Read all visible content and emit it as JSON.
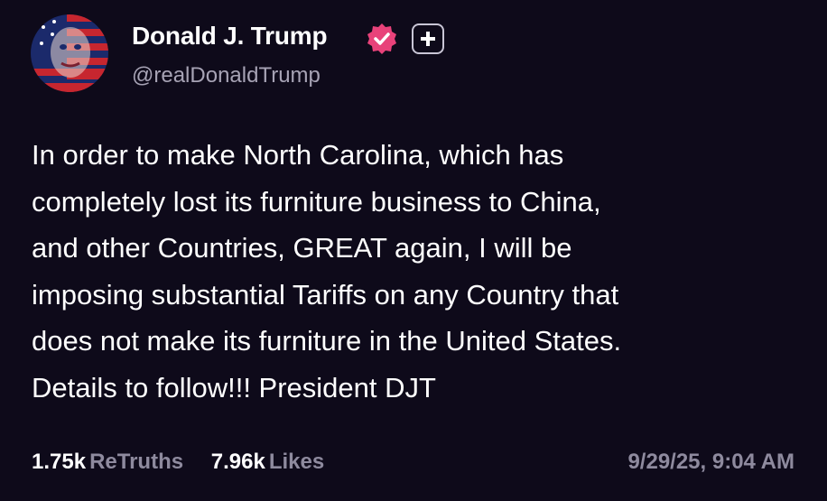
{
  "author": {
    "display_name": "Donald J. Trump",
    "handle": "@realDonaldTrump",
    "avatar_icon": "flag-portrait-avatar",
    "verified_icon": "verified-badge-icon",
    "follow_icon": "plus-icon"
  },
  "post": {
    "lines": [
      "In order to make North Carolina, which has",
      "completely lost its furniture business to China,",
      "and other Countries, GREAT again, I will be",
      "imposing substantial Tariffs on any Country that",
      "does not make its furniture in the United States.",
      "Details to follow!!! President DJT"
    ]
  },
  "stats": {
    "retruths_count": "1.75k",
    "retruths_label": "ReTruths",
    "likes_count": "7.96k",
    "likes_label": "Likes"
  },
  "timestamp": "9/29/25, 9:04 AM",
  "colors": {
    "background": "#0e0a1a",
    "text": "#ffffff",
    "muted": "#8e8a9e",
    "verified": "#e8427a"
  }
}
